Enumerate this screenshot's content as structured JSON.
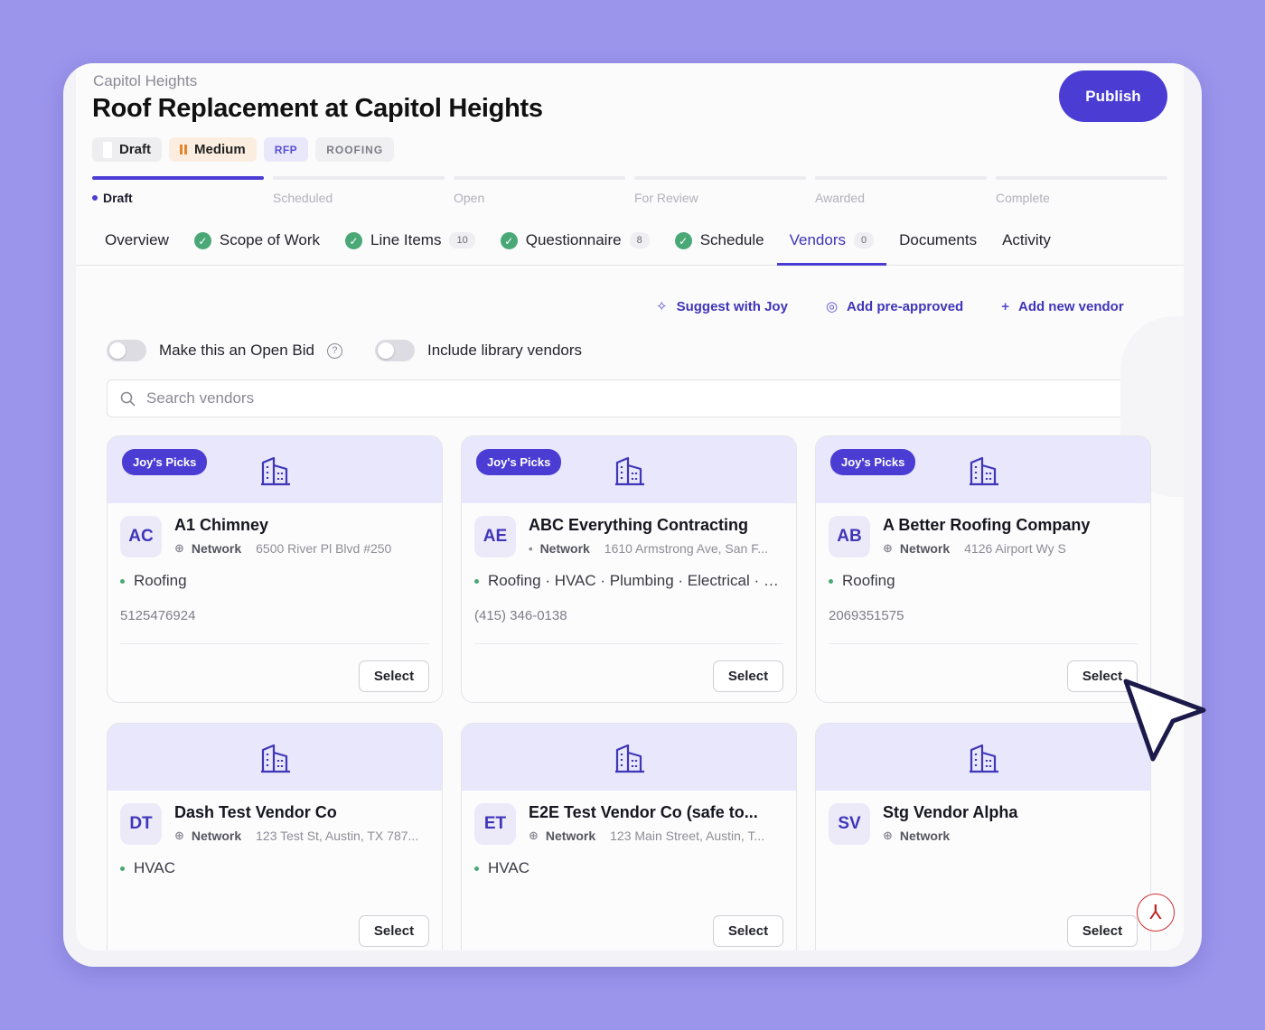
{
  "header": {
    "location": "Capitol Heights",
    "title": "Roof Replacement at Capitol Heights",
    "publish_label": "Publish",
    "tags": {
      "draft": "Draft",
      "priority": "Medium",
      "type": "RFP",
      "category": "ROOFING"
    }
  },
  "stages": [
    "Draft",
    "Scheduled",
    "Open",
    "For Review",
    "Awarded",
    "Complete"
  ],
  "tabs": {
    "overview": "Overview",
    "scope": "Scope of Work",
    "line_items": "Line Items",
    "line_items_count": "10",
    "questionnaire": "Questionnaire",
    "questionnaire_count": "8",
    "schedule": "Schedule",
    "vendors": "Vendors",
    "vendors_count": "0",
    "documents": "Documents",
    "activity": "Activity"
  },
  "actions": {
    "suggest": "Suggest with Joy",
    "preapproved": "Add pre-approved",
    "new_vendor": "Add new vendor"
  },
  "toggles": {
    "open_bid": "Make this an Open Bid",
    "library": "Include library vendors"
  },
  "search": {
    "placeholder": "Search vendors"
  },
  "vendors": [
    {
      "badge": "Joy's Picks",
      "initials": "AC",
      "name": "A1 Chimney",
      "network": "Network",
      "address": "6500 River Pl Blvd #250",
      "trades": "Roofing",
      "phone": "5125476924",
      "select": "Select"
    },
    {
      "badge": "Joy's Picks",
      "initials": "AE",
      "name": "ABC Everything Contracting",
      "network": "Network",
      "address": "1610 Armstrong Ave, San F...",
      "trades": "Roofing · HVAC · Plumbing · Electrical · Ex...",
      "phone": "(415) 346-0138",
      "select": "Select"
    },
    {
      "badge": "Joy's Picks",
      "initials": "AB",
      "name": "A Better Roofing Company",
      "network": "Network",
      "address": "4126 Airport Wy S",
      "trades": "Roofing",
      "phone": "2069351575",
      "select": "Select"
    },
    {
      "initials": "DT",
      "name": "Dash Test Vendor Co",
      "network": "Network",
      "address": "123 Test St, Austin, TX 787...",
      "trades": "HVAC",
      "select": "Select"
    },
    {
      "initials": "ET",
      "name": "E2E Test Vendor Co (safe to...",
      "network": "Network",
      "address": "123 Main Street, Austin, T...",
      "trades": "HVAC",
      "select": "Select"
    },
    {
      "initials": "SV",
      "name": "Stg Vendor Alpha",
      "network": "Network",
      "select": "Select"
    }
  ],
  "colors": {
    "accent": "#4b3dd3",
    "background": "#9b95ec",
    "success": "#4aa877"
  }
}
